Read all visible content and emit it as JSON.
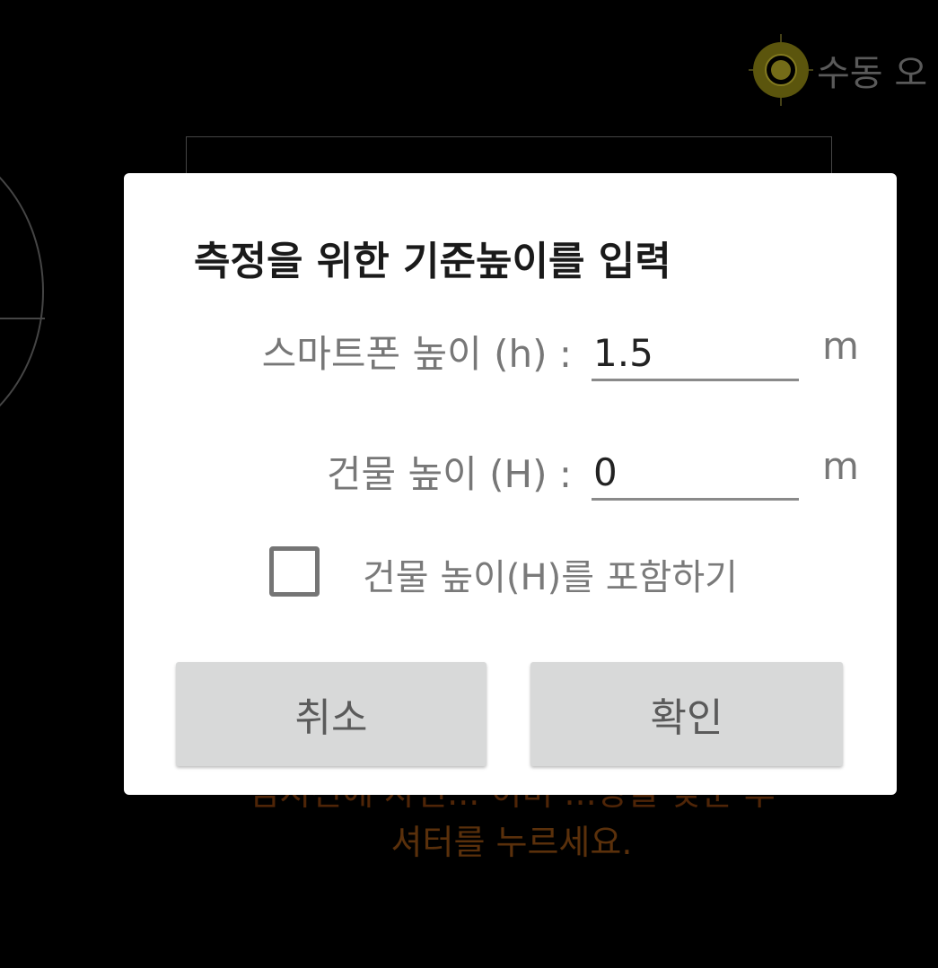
{
  "background": {
    "mode_label": "수동 오",
    "mode_icon": "target-crosshair-icon",
    "hint_text": "셔터를 누르세요.",
    "hint_partial": "심지선에 자신... 이미 ...상을 맞춘 후"
  },
  "dialog": {
    "title": "측정을 위한 기준높이를 입력",
    "phone_height": {
      "label": "스마트폰 높이 (h) :",
      "value": "1.5",
      "unit": "m"
    },
    "building_height": {
      "label": "건물 높이 (H) :",
      "value": "0",
      "unit": "m"
    },
    "include_building": {
      "label": "건물 높이(H)를 포함하기",
      "checked": false
    },
    "cancel_label": "취소",
    "ok_label": "확인"
  },
  "colors": {
    "background": "#000000",
    "dialog_bg": "#ffffff",
    "button_bg": "#d8d9d9",
    "accent_icon": "#a79a1a",
    "hint_text": "#8a4a12"
  }
}
